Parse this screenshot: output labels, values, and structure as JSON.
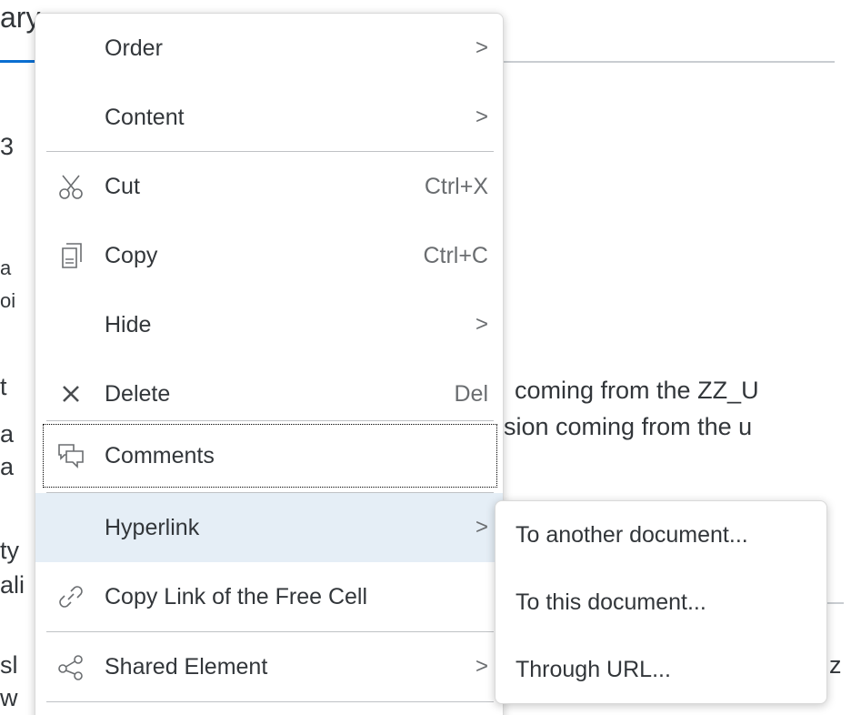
{
  "background": {
    "title_fragment": "ary",
    "fragments": [
      "3",
      "a",
      "oi",
      "t",
      "a",
      "a",
      "ty",
      "ali",
      "sl",
      "w",
      "coming from the ZZ_U",
      "sion coming from the u",
      "z"
    ]
  },
  "menu": {
    "items": [
      {
        "label": "Order",
        "icon": "",
        "shortcut": "",
        "submenu": true
      },
      {
        "label": "Content",
        "icon": "",
        "shortcut": "",
        "submenu": true
      },
      {
        "label": "Cut",
        "icon": "scissors-icon",
        "shortcut": "Ctrl+X",
        "submenu": false
      },
      {
        "label": "Copy",
        "icon": "copy-icon",
        "shortcut": "Ctrl+C",
        "submenu": false
      },
      {
        "label": "Hide",
        "icon": "",
        "shortcut": "",
        "submenu": true
      },
      {
        "label": "Delete",
        "icon": "close-icon",
        "shortcut": "Del",
        "submenu": false
      },
      {
        "label": "Comments",
        "icon": "comments-icon",
        "shortcut": "",
        "submenu": false
      },
      {
        "label": "Hyperlink",
        "icon": "",
        "shortcut": "",
        "submenu": true
      },
      {
        "label": "Copy Link of the Free Cell",
        "icon": "link-icon",
        "shortcut": "",
        "submenu": false
      },
      {
        "label": "Shared Element",
        "icon": "share-icon",
        "shortcut": "",
        "submenu": true
      }
    ],
    "arrow_glyph": ">"
  },
  "submenu": {
    "items": [
      {
        "label": "To another document..."
      },
      {
        "label": "To this document..."
      },
      {
        "label": "Through URL..."
      }
    ]
  },
  "colors": {
    "hover_background": "#e5eef6",
    "text": "#32363a",
    "secondary_text": "#6a6d70",
    "accent_rule": "#0a6ed1"
  }
}
